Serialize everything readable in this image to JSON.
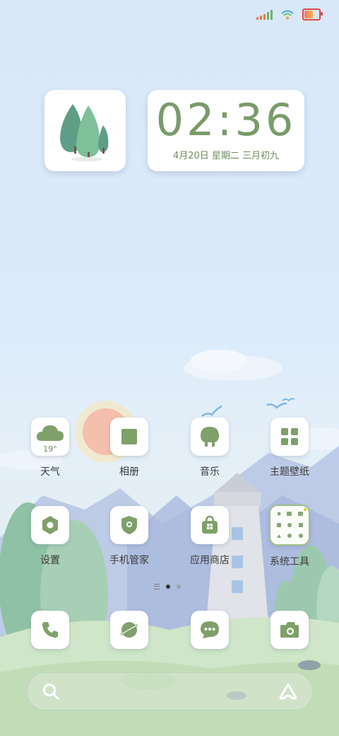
{
  "status_bar": {
    "signal_icon": "signal-icon",
    "wifi_icon": "wifi-icon",
    "battery_icon": "battery-icon",
    "battery_level": 0.6
  },
  "widgets": {
    "clock": {
      "time": "02:36",
      "date": "4月20日 星期二 三月初九"
    },
    "tree": {
      "icon": "tree-icon"
    }
  },
  "apps_row1": [
    {
      "label": "天气",
      "icon": "weather-cloud-icon",
      "temp": "19°"
    },
    {
      "label": "相册",
      "icon": "gallery-icon"
    },
    {
      "label": "音乐",
      "icon": "music-icon"
    },
    {
      "label": "主题壁纸",
      "icon": "theme-icon"
    }
  ],
  "apps_row2": [
    {
      "label": "设置",
      "icon": "settings-icon"
    },
    {
      "label": "手机管家",
      "icon": "security-icon"
    },
    {
      "label": "应用商店",
      "icon": "app-store-icon"
    },
    {
      "label": "系统工具",
      "icon": "system-tools-folder-icon"
    }
  ],
  "dock": [
    {
      "icon": "phone-icon"
    },
    {
      "icon": "browser-icon"
    },
    {
      "icon": "messages-icon"
    },
    {
      "icon": "camera-icon"
    }
  ],
  "pager": {
    "pages": 2,
    "active": 1
  },
  "search": {
    "icon": "search-icon",
    "assistant_icon": "assistant-icon"
  },
  "colors": {
    "accent": "#7fa06a",
    "sky": "#dcebfa"
  }
}
